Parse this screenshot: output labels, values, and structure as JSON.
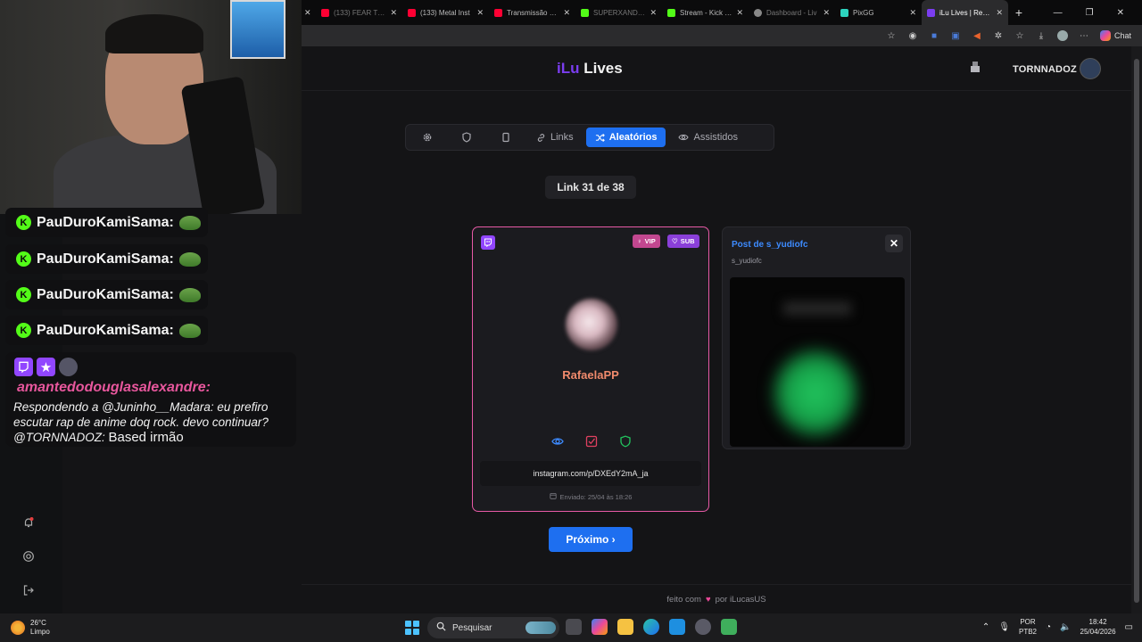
{
  "browser": {
    "tabs": [
      {
        "label": "(133) FEAR THE",
        "color": "#ff0033",
        "state": "dim"
      },
      {
        "label": "(133) Metal Inst",
        "color": "#ff0033",
        "state": "normal"
      },
      {
        "label": "Transmissão ao v",
        "color": "#ff0033",
        "state": "normal"
      },
      {
        "label": "SUPERXANDAO",
        "color": "#53fc18",
        "state": "dim"
      },
      {
        "label": "Stream - Kick Da",
        "color": "#53fc18",
        "state": "normal"
      },
      {
        "label": "Dashboard - Liv",
        "color": "#888888",
        "state": "dim"
      },
      {
        "label": "PixGG",
        "color": "#2dd4bf",
        "state": "normal"
      },
      {
        "label": "iLu Lives | React",
        "color": "#7b3df0",
        "state": "active"
      }
    ],
    "new_tab": "+",
    "chat_label": "Chat"
  },
  "site": {
    "logo_part1": "iLu",
    "logo_part2": "Lives",
    "user_name": "TORNNADOZ",
    "nav": {
      "links_label": "Links",
      "random_label": "Aleatórios",
      "watched_label": "Assistidos"
    },
    "counter": "Link 31 de 38",
    "card": {
      "badge_vip": "VIP",
      "badge_sub": "SUB",
      "username": "RafaelaPP",
      "link": "instagram.com/p/DXEdY2mA_ja",
      "sent": "Enviado: 25/04 às 18:26"
    },
    "post": {
      "title": "Post de s_yudiofc",
      "subtitle": "s_yudiofc",
      "close": "✕"
    },
    "next_label": "Próximo ›",
    "footer": {
      "text1": "feito com",
      "heart": "♥",
      "text2": "por iLucasUS"
    }
  },
  "stream_chat": {
    "lines": [
      {
        "name": "PauDuroKamiSama:"
      },
      {
        "name": "PauDuroKamiSama:"
      },
      {
        "name": "PauDuroKamiSama:"
      },
      {
        "name": "PauDuroKamiSama:"
      }
    ],
    "kick_letter": "K",
    "big_message": {
      "author": "amantedodouglasalexandre:",
      "reply_text": "Respondendo a @Juninho__Madara: eu prefiro escutar rap de anime doq rock. devo continuar? @TORNNADOZ:",
      "plain_text": "Based irmão"
    }
  },
  "taskbar": {
    "temperature": "26°C",
    "weather": "Limpo",
    "search_label": "Pesquisar",
    "lang_top": "POR",
    "lang_bottom": "PTB2",
    "time": "18:42",
    "date": "25/04/2026"
  }
}
